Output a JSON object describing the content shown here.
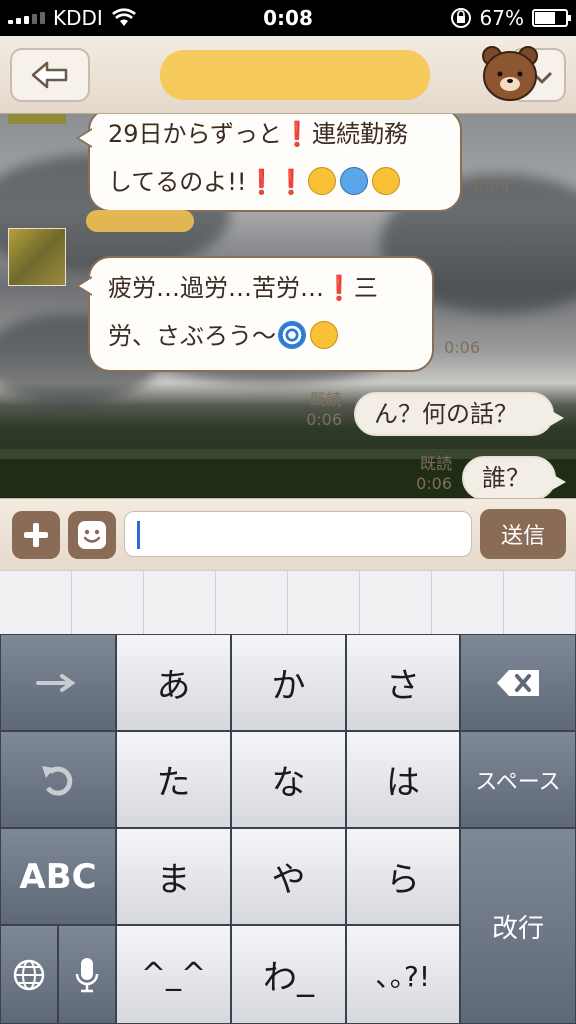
{
  "status_bar": {
    "carrier": "KDDI",
    "time": "0:08",
    "battery_percent": "67%",
    "battery_level": 0.67
  },
  "header": {
    "back_icon": "back-arrow-icon",
    "avatar_icon": "brown-bear-avatar",
    "menu_icon": "chevron-down-icon"
  },
  "messages": [
    {
      "side": "left",
      "line1": "29日からずっと",
      "line1_end": "連続勤務",
      "line2": "してるのよ!!",
      "time": "0:04"
    },
    {
      "side": "left",
      "line1": "疲労…過労…苦労…",
      "line1_end": "三",
      "line2": "労、さぶろう〜",
      "time": "0:06"
    },
    {
      "side": "right",
      "text": "ん？何の話？",
      "read": "既読",
      "time": "0:06"
    },
    {
      "side": "right",
      "text": "誰？",
      "read": "既読",
      "time": "0:06"
    }
  ],
  "input_bar": {
    "plus_icon": "plus-icon",
    "sticker_icon": "smiley-icon",
    "send_label": "送信",
    "input_value": ""
  },
  "keyboard": {
    "keys": {
      "a": "あ",
      "ka": "か",
      "sa": "さ",
      "ta": "た",
      "na": "な",
      "ha": "は",
      "ma": "ま",
      "ya": "や",
      "ra": "ら",
      "face": "^_^",
      "wa": "わ_",
      "punct": "､｡?!",
      "abc": "ABC",
      "space": "スペース",
      "enter": "改行"
    }
  },
  "colors": {
    "accent_brown": "#8a6b56",
    "bubble_border": "#8b6c55",
    "emphasis_red": "#e01a1a"
  }
}
